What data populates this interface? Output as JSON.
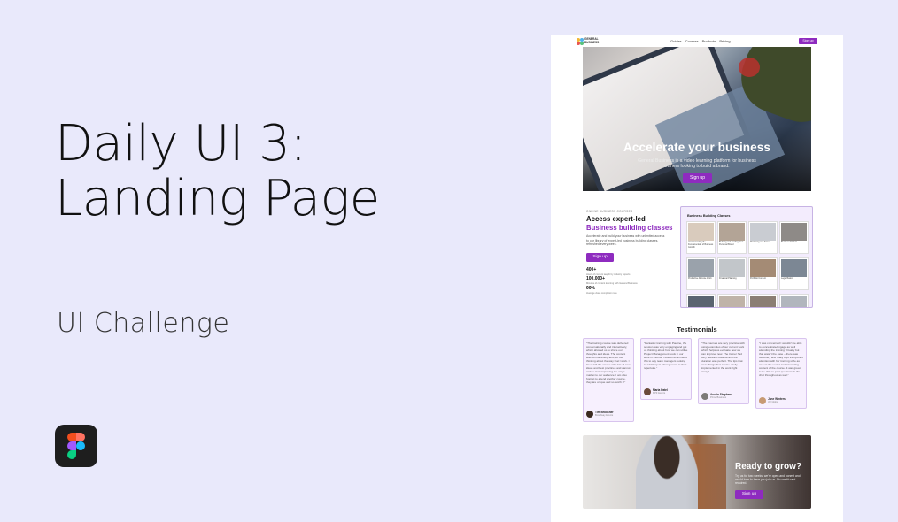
{
  "presentation": {
    "title_line1": "Daily UI 3:",
    "title_line2": "Landing Page",
    "subtitle": "UI Challenge",
    "tool_icon": "figma-icon"
  },
  "mock": {
    "nav": {
      "logo_text": "GENERAL BUSINESS",
      "links": [
        "Guides",
        "Courses",
        "Products",
        "Pricing"
      ],
      "signup_label": "Sign up"
    },
    "hero": {
      "heading": "Accelerate your business",
      "description": "General Business is a video learning platform for business owners looking to build a brand.",
      "cta_label": "Sign up"
    },
    "classes_section": {
      "eyebrow": "ONLINE BUSINESS COURSES",
      "title_line1": "Access expert-led",
      "title_line2": "Business building classes",
      "description": "Accelerate and build your business with unlimited access to our library of expert-led business building classes, refreshed every week.",
      "cta_label": "Sign up",
      "stats": [
        {
          "value": "400+",
          "label": "Hours of content taught by industry experts"
        },
        {
          "value": "100,000+",
          "label": "Minutes of content learning with General Business"
        },
        {
          "value": "90%",
          "label": "Average class completion rate"
        }
      ],
      "panel_title": "Business Building Classes",
      "cards": [
        {
          "label": "Understanding the Fundamentals of Business Growth"
        },
        {
          "label": "Building and Scaling Your Personal Brand"
        },
        {
          "label": "Marketing and Sales"
        },
        {
          "label": "Business Models"
        },
        {
          "label": "Productive Remote Work"
        },
        {
          "label": "Financial Planning"
        },
        {
          "label": "Portfolio Content"
        },
        {
          "label": "Legal Basics"
        },
        {
          "label": ""
        },
        {
          "label": ""
        },
        {
          "label": ""
        },
        {
          "label": ""
        }
      ]
    },
    "testimonials": {
      "heading": "Testimonials",
      "items": [
        {
          "quote": "\"The training course was delivered conversationally and interactively, which allowed us to share our thoughts and ideas. The content was so interesting and got me thinking about the way that I work. I knew left the course with lots of new ideas and best practices and cannot wait to start improving the way I market to our audience. I am also hoping to attend another course, they are unique and so worth it!\"",
          "name": "Tim Brookner",
          "role": "Broadway Events"
        },
        {
          "quote": "\"Fantastic training with Pauline, the session was very engaging and got us thinking about how we can utilise Project Management tools in our work in Events. I would recommend this to any team managers looking to add Project Management to their repertoire.\"",
          "name": "Maria Patel",
          "role": "MPF Events"
        },
        {
          "quote": "\"The courses are very practical with using examples of our current work which helps us evaluate how we can improve now. The trainer had very relevant material and the duration was perfect. The tips that were things that can be easily implemented in the work right away.\"",
          "name": "Austin Stephens",
          "role": "Prime Business"
        },
        {
          "quote": "\"I was concerned I wouldn't be able to concentrate/engage as well attending the training virtually but that wasn't the case – there was discovery and really kept everyone's attention with her training style as well as the useful and interesting content of the course. It was great to be able to post questions in the chat throughout as well.\"",
          "name": "Jane Winters",
          "role": "JW Global"
        }
      ]
    },
    "cta": {
      "heading": "Ready to grow?",
      "description": "Try us for two weeks, we're open and honest and would love to have you join us. No credit card required.",
      "cta_label": "Sign up"
    }
  },
  "colors": {
    "background": "#e9e9fb",
    "accent_purple": "#8e2bbf",
    "card_tint": "#f7f0fe"
  }
}
